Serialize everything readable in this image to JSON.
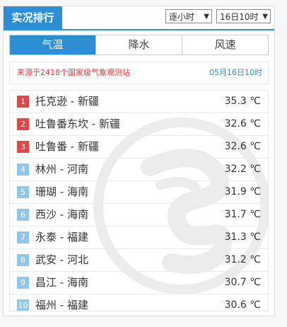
{
  "header": {
    "title": "实况排行",
    "mode_select": "逐小时",
    "time_select": "16日10时"
  },
  "tabs": [
    {
      "label": "气温",
      "active": true
    },
    {
      "label": "降水",
      "active": false
    },
    {
      "label": "风速",
      "active": false
    }
  ],
  "source": {
    "text": "来源于2418个国家级气象观测站",
    "update_time": "05月16日10时"
  },
  "colors": {
    "accent": "#2d8fd3",
    "top_rank": "#e24545",
    "other_rank": "#8fc6ea",
    "source_text": "#e23b3b"
  },
  "rankings": [
    {
      "rank": "1",
      "station": "托克逊 - 新疆",
      "temp": "35.3 ℃"
    },
    {
      "rank": "2",
      "station": "吐鲁番东坎 - 新疆",
      "temp": "32.6 ℃"
    },
    {
      "rank": "3",
      "station": "吐鲁番 - 新疆",
      "temp": "32.6 ℃"
    },
    {
      "rank": "4",
      "station": "林州 - 河南",
      "temp": "32.2 ℃"
    },
    {
      "rank": "5",
      "station": "珊瑚 - 海南",
      "temp": "31.9 ℃"
    },
    {
      "rank": "6",
      "station": "西沙 - 海南",
      "temp": "31.7 ℃"
    },
    {
      "rank": "7",
      "station": "永泰 - 福建",
      "temp": "31.3 ℃"
    },
    {
      "rank": "8",
      "station": "武安 - 河北",
      "temp": "31.2 ℃"
    },
    {
      "rank": "9",
      "station": "昌江 - 海南",
      "temp": "30.7 ℃"
    },
    {
      "rank": "10",
      "station": "福州 - 福建",
      "temp": "30.6 ℃"
    }
  ]
}
